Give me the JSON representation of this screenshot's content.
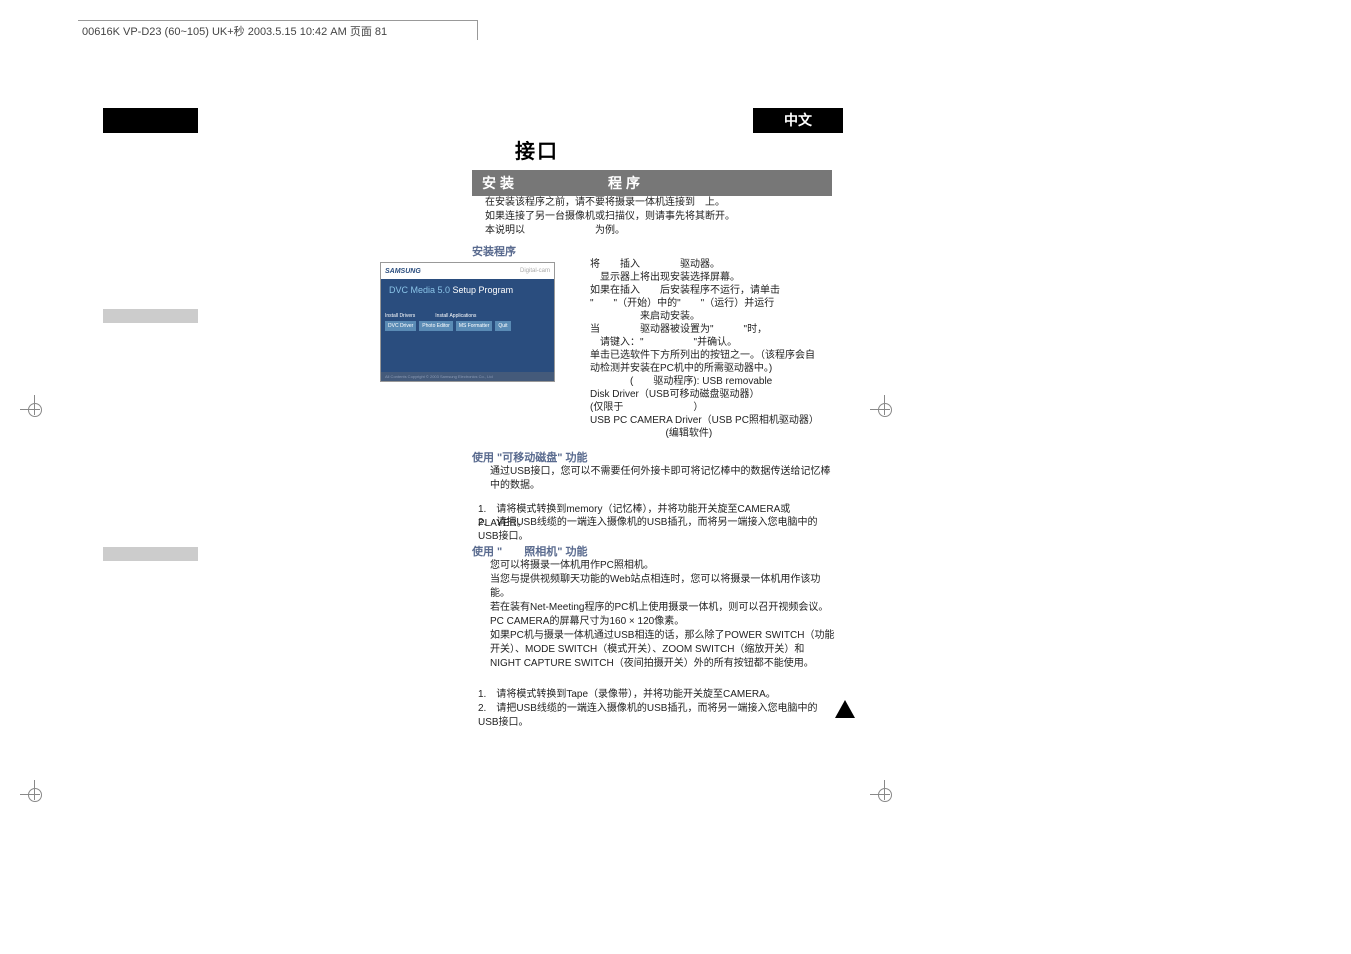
{
  "header_text": "00616K VP-D23 (60~105) UK+秒 2003.5.15 10:42 AM 页面 81",
  "language_label": "中文",
  "main_title": "接口",
  "section1_title": "安装　　　　　程序",
  "intro_line1": "在安装该程序之前，请不要将摄录一体机连接到　上。",
  "intro_line2": "如果连接了另一台摄像机或扫描仪，则请事先将其断开。",
  "intro_line3": "本说明以　　　　　　　为例。",
  "subsection1_title": "安装程序",
  "installer": {
    "brand": "SAMSUNG",
    "product": "Digital-cam",
    "title_prefix": "DVC Media 5.0",
    "title_suffix": " Setup Program",
    "section_label_1": "Install Drivers",
    "section_label_2": "Install Applications",
    "btn1": "DVC Driver",
    "btn2": "Photo Editor",
    "btn3": "MS Formatter",
    "btn4": "Quit",
    "footer": "All Contents Copyright © 2003 Samsung Electronics Co., Ltd"
  },
  "steps": "将　　插入　　　　驱动器。\n　显示器上将出现安装选择屏幕。\n如果在插入　　后安装程序不运行，请单击\n\"　　\"（开始）中的\"　　\"（运行）并运行\n　　　　　来启动安装。\n当　　　　驱动器被设置为\"　　　\"时，\n　请键入：\"　　　　　\"并确认。\n单击已选软件下方所列出的按钮之一。（该程序会自\n动检测并安装在PC机中的所需驱动器中。)\n　　　　(　　驱动程序): USB removable\n  Disk Driver（USB可移动磁盘驱动器）\n  (仅限于　　　　　　　）\n  USB PC CAMERA Driver（USB PC照相机驱动器）\n　　　　　　 　 (编辑软件)",
  "subsection2_title": "使用 \"可移动磁盘\" 功能",
  "body2_text": "通过USB接口，您可以不需要任何外接卡即可将记忆棒中的数据传送给记忆棒中的数据。",
  "list2_item1": "1.　请将模式转换到memory（记忆棒），并将功能开关旋至CAMERA或PLAYER。",
  "list2_item2": "2.　请把USB线缆的一端连入摄像机的USB插孔，而将另一端接入您电脑中的USB接口。",
  "subsection3_title": "使用 \"　　照相机\" 功能",
  "body3_line1": "您可以将摄录一体机用作PC照相机。",
  "body3_line2": "当您与提供视频聊天功能的Web站点相连时，您可以将摄录一体机用作该功能。",
  "body3_line3": "若在装有Net-Meeting程序的PC机上使用摄录一体机，则可以召开视频会议。",
  "body3_line4": "PC CAMERA的屏幕尺寸为160 × 120像素。",
  "body3_line5": "如果PC机与摄录一体机通过USB相连的话，那么除了POWER SWITCH（功能开关）、MODE SWITCH（模式开关）、ZOOM SWITCH（缩放开关）和NIGHT CAPTURE SWITCH（夜间拍摄开关）外的所有按钮都不能使用。",
  "list3_item1": "1.　请将模式转换到Tape（录像带），并将功能开关旋至CAMERA。",
  "list3_item2": "2.　请把USB线缆的一端连入摄像机的USB插孔，而将另一端接入您电脑中的USB接口。"
}
